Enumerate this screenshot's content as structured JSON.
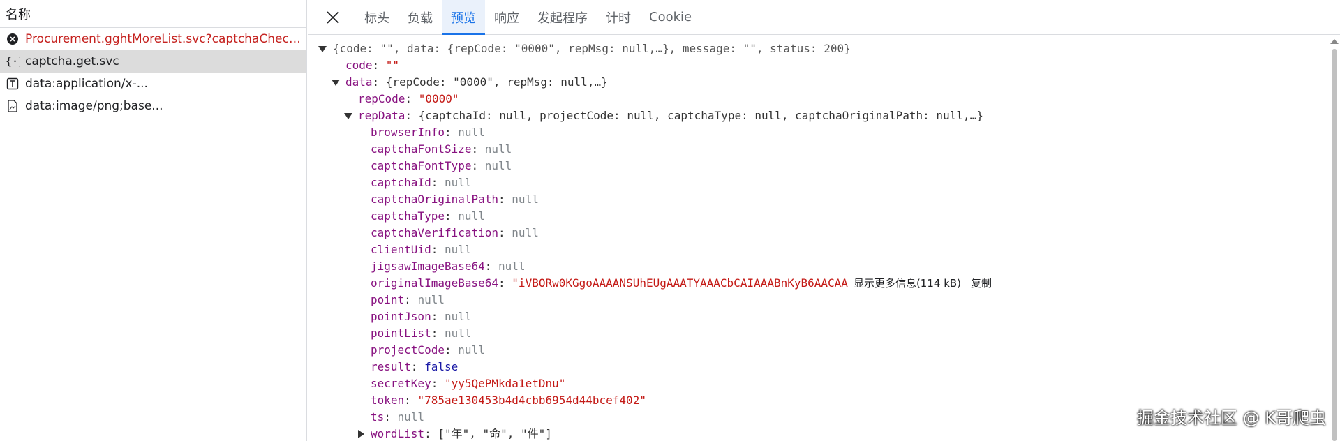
{
  "left": {
    "header": "名称",
    "requests": [
      {
        "label": "Procurement.gghtMoreList.svc?captchaCheckFla...",
        "icon": "error-icon",
        "status": "error"
      },
      {
        "label": "captcha.get.svc",
        "icon": "braces-icon",
        "status": "selected"
      },
      {
        "label": "data:application/x-...",
        "icon": "text-file-icon",
        "status": "normal"
      },
      {
        "label": "data:image/png;base...",
        "icon": "image-file-icon",
        "status": "normal"
      }
    ]
  },
  "tabs": {
    "items": [
      "标头",
      "负载",
      "预览",
      "响应",
      "发起程序",
      "计时",
      "Cookie"
    ],
    "active": "预览"
  },
  "preview": {
    "root_summary": "{code: \"\", data: {repCode: \"0000\", repMsg: null,…}, message: \"\", status: 200}",
    "code_key": "code",
    "code_val": "\"\"",
    "data_key": "data",
    "data_summary": "{repCode: \"0000\", repMsg: null,…}",
    "repCode_key": "repCode",
    "repCode_val": "\"0000\"",
    "repData_key": "repData",
    "repData_summary": "{captchaId: null, projectCode: null, captchaType: null, captchaOriginalPath: null,…}",
    "fields": [
      {
        "key": "browserInfo",
        "val": "null",
        "type": "null"
      },
      {
        "key": "captchaFontSize",
        "val": "null",
        "type": "null"
      },
      {
        "key": "captchaFontType",
        "val": "null",
        "type": "null"
      },
      {
        "key": "captchaId",
        "val": "null",
        "type": "null"
      },
      {
        "key": "captchaOriginalPath",
        "val": "null",
        "type": "null"
      },
      {
        "key": "captchaType",
        "val": "null",
        "type": "null"
      },
      {
        "key": "captchaVerification",
        "val": "null",
        "type": "null"
      },
      {
        "key": "clientUid",
        "val": "null",
        "type": "null"
      },
      {
        "key": "jigsawImageBase64",
        "val": "null",
        "type": "null"
      },
      {
        "key": "originalImageBase64",
        "val": "\"iVBORw0KGgoAAAANSUhEUgAAATYAAACbCAIAAABnKyB6AACAA",
        "type": "str2"
      },
      {
        "key": "point",
        "val": "null",
        "type": "null"
      },
      {
        "key": "pointJson",
        "val": "null",
        "type": "null"
      },
      {
        "key": "pointList",
        "val": "null",
        "type": "null"
      },
      {
        "key": "projectCode",
        "val": "null",
        "type": "null"
      },
      {
        "key": "result",
        "val": "false",
        "type": "bool"
      },
      {
        "key": "secretKey",
        "val": "\"yy5QePMkda1etDnu\"",
        "type": "str2"
      },
      {
        "key": "token",
        "val": "\"785ae130453b4d4cbb6954d44bcef402\"",
        "type": "str2"
      },
      {
        "key": "ts",
        "val": "null",
        "type": "null"
      }
    ],
    "show_more_label": "显示更多信息(114 kB)",
    "copy_label": "复制",
    "wordList_key": "wordList",
    "wordList_val": "[\"年\", \"命\", \"件\"]"
  },
  "watermark": "掘金技术社区 @ K哥爬虫",
  "colors": {
    "accent": "#1a73e8",
    "key": "#881280",
    "string": "#c41a16",
    "null": "#80868b",
    "error": "#c5221f"
  }
}
